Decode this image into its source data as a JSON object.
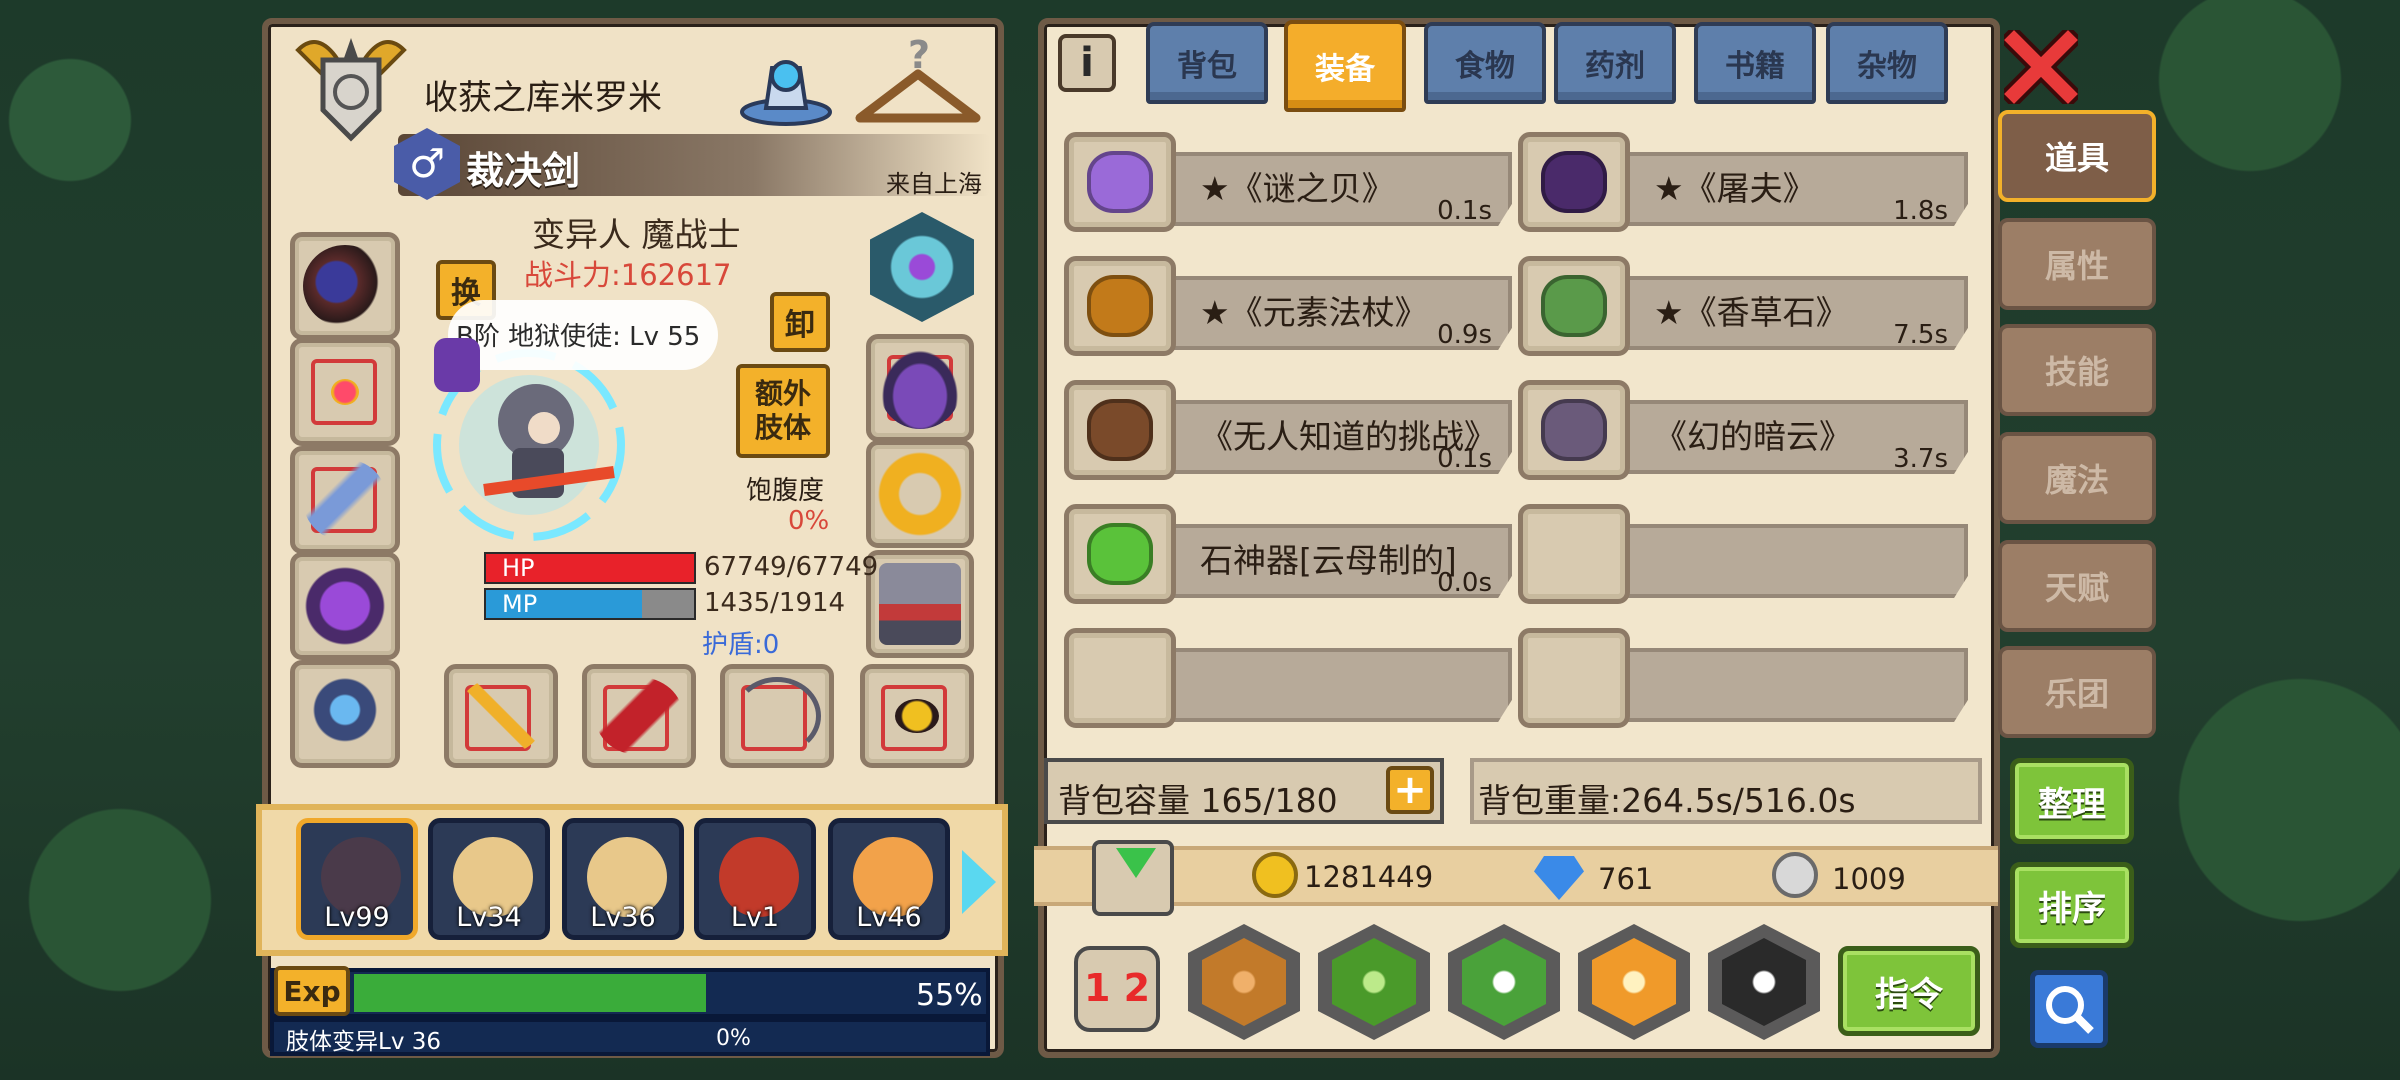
{
  "character": {
    "guild_name": "收获之库米罗米",
    "title": "裁决剑",
    "origin": "来自上海",
    "class": "变异人 魔战士",
    "power": "战斗力:162617",
    "swap_label": "换",
    "unequip_label": "卸",
    "extra_limb_label": "额外\n肢体",
    "rank_text": "B阶 地狱使徒: Lv 55",
    "satiety_label": "饱腹度",
    "satiety_value": "0%",
    "hp_label": "HP",
    "hp_value": "67749/67749",
    "hp_fraction": 1.0,
    "mp_label": "MP",
    "mp_value": "1435/1914",
    "mp_fraction": 0.75,
    "shield": "护盾:0",
    "gender_symbol": "♂"
  },
  "party": [
    {
      "level": "Lv99",
      "color": "#4a3a4a"
    },
    {
      "level": "Lv34",
      "color": "#e8c88a"
    },
    {
      "level": "Lv36",
      "color": "#e8c88a"
    },
    {
      "level": "Lv1",
      "color": "#c23a2a"
    },
    {
      "level": "Lv46",
      "color": "#f2a24a"
    }
  ],
  "exp": {
    "label": "Exp",
    "percent_text": "55%",
    "fraction": 0.55,
    "sub_label": "肢体变异Lv 36",
    "sub_percent": "0%"
  },
  "tabs": [
    "背包",
    "装备",
    "食物",
    "药剂",
    "书籍",
    "杂物"
  ],
  "active_tab": "装备",
  "info_icon": "i",
  "items": [
    {
      "name": "★《谜之贝》",
      "weight": "0.1s",
      "icon": "shell-icon",
      "color": "#9a6ad8"
    },
    {
      "name": "★《屠夫》",
      "weight": "1.8s",
      "icon": "axe-icon",
      "color": "#4a2a6a"
    },
    {
      "name": "★《元素法杖》",
      "weight": "0.9s",
      "icon": "staff-icon",
      "color": "#c27a1a"
    },
    {
      "name": "★《香草石》",
      "weight": "7.5s",
      "icon": "stone-icon",
      "color": "#5a9a4a"
    },
    {
      "name": "《无人知道的挑战》",
      "weight": "0.1s",
      "icon": "crossbow-icon",
      "color": "#7a4a2a"
    },
    {
      "name": "《幻的暗云》",
      "weight": "3.7s",
      "icon": "helmet-icon",
      "color": "#6a5a7a"
    },
    {
      "name": "石神器[云母制的]",
      "weight": "0.0s",
      "icon": "gem-icon",
      "color": "#5ac23a"
    },
    {
      "name": "",
      "weight": "",
      "icon": "",
      "color": ""
    },
    {
      "name": "",
      "weight": "",
      "icon": "",
      "color": ""
    },
    {
      "name": "",
      "weight": "",
      "icon": "",
      "color": ""
    }
  ],
  "capacity": "背包容量 165/180",
  "weight": "背包重量:264.5s/516.0s",
  "currency": {
    "gold": "1281449",
    "gems": "761",
    "silver": "1009"
  },
  "side_tabs": [
    "道具",
    "属性",
    "技能",
    "魔法",
    "天赋",
    "乐团"
  ],
  "active_side": "道具",
  "buttons": {
    "sort": "整理",
    "order": "排序",
    "command": "指令",
    "page_badge": "1 2"
  }
}
